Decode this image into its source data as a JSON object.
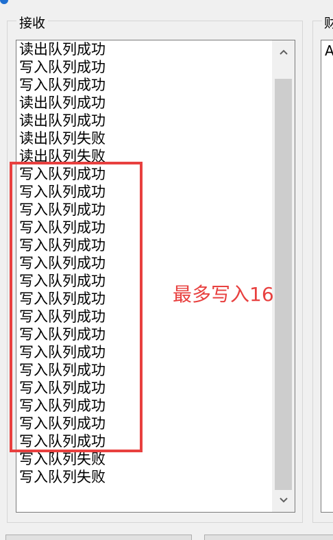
{
  "receive_group": {
    "label": "接收",
    "items": [
      "读出队列成功",
      "写入队列成功",
      "写入队列成功",
      "读出队列成功",
      "读出队列成功",
      "读出队列失败",
      "读出队列失败",
      "写入队列成功",
      "写入队列成功",
      "写入队列成功",
      "写入队列成功",
      "写入队列成功",
      "写入队列成功",
      "写入队列成功",
      "写入队列成功",
      "写入队列成功",
      "写入队列成功",
      "写入队列成功",
      "写入队列成功",
      "写入队列成功",
      "写入队列成功",
      "写入队列成功",
      "写入队列成功",
      "写入队列失败",
      "写入队列失败"
    ]
  },
  "annotation": {
    "text": "最多写入16",
    "color": "#e8403f"
  },
  "right_group": {
    "label": "财",
    "first_item": "A"
  },
  "scrollbar": {
    "up_icon": "chevron-up-icon",
    "down_icon": "chevron-down-icon"
  }
}
